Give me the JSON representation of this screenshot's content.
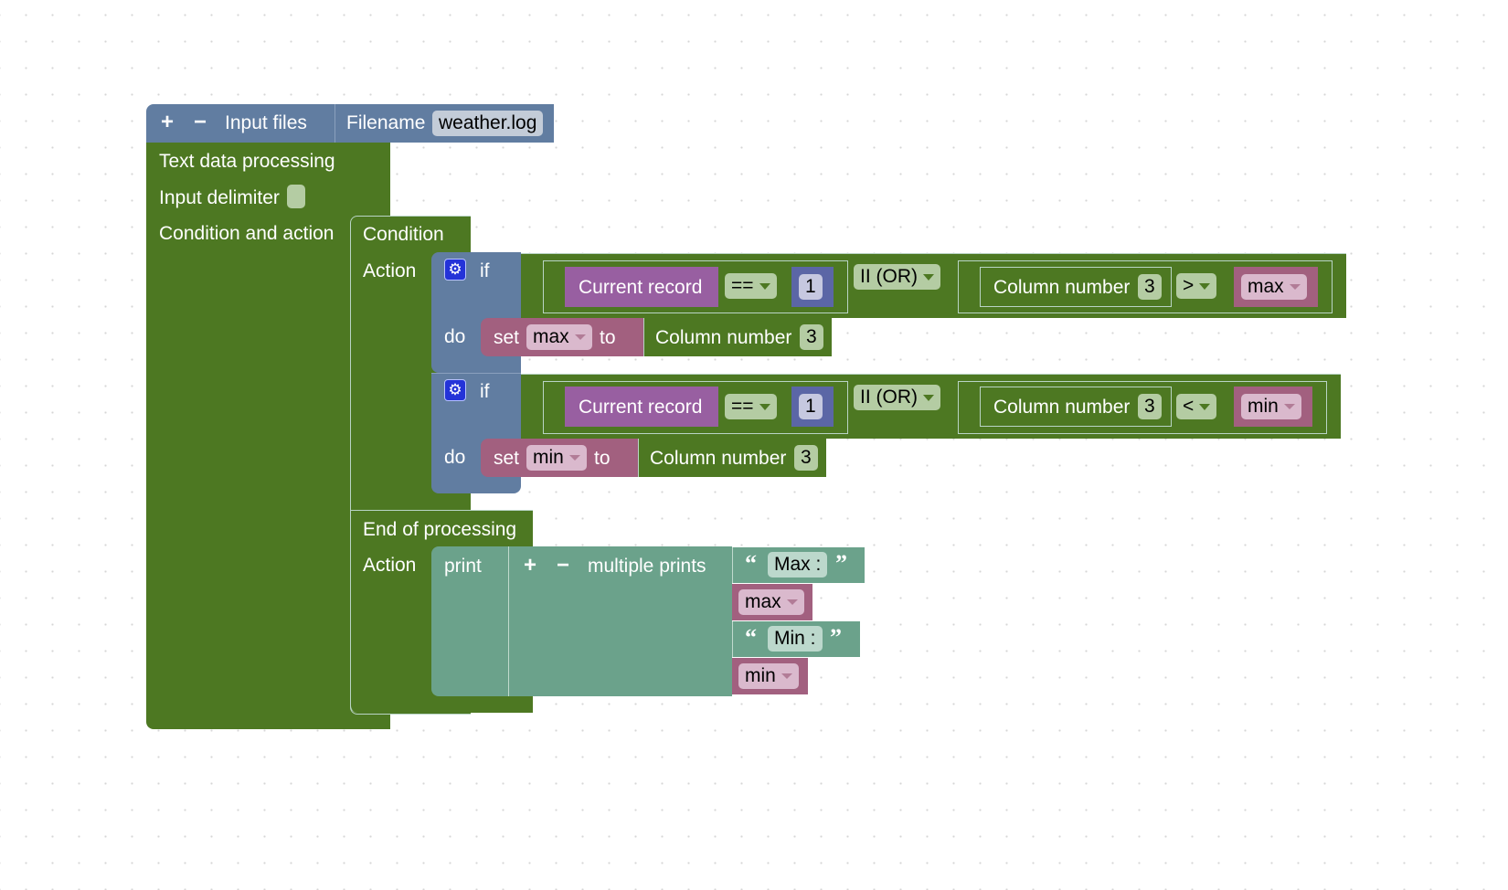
{
  "input_files_block": {
    "add_label": "+",
    "remove_label": "−",
    "title": "Input files",
    "filename_label": "Filename",
    "filename_value": "weather.log"
  },
  "text_processing_block": {
    "title": "Text data processing",
    "delimiter_label": "Input delimiter",
    "delimiter_value": "",
    "condition_action_label": "Condition and action"
  },
  "condition_block": {
    "condition_label": "Condition",
    "action_label": "Action"
  },
  "if_blocks": [
    {
      "if_label": "if",
      "do_label": "do",
      "left": {
        "field": "Current record",
        "operator": "==",
        "value": "1"
      },
      "logic": "II (OR)",
      "right": {
        "field": "Column number",
        "column": "3",
        "operator": ">",
        "variable": "max"
      },
      "set": {
        "set_label": "set",
        "variable": "max",
        "to_label": "to",
        "value_label": "Column number",
        "value_column": "3"
      }
    },
    {
      "if_label": "if",
      "do_label": "do",
      "left": {
        "field": "Current record",
        "operator": "==",
        "value": "1"
      },
      "logic": "II (OR)",
      "right": {
        "field": "Column number",
        "column": "3",
        "operator": "<",
        "variable": "min"
      },
      "set": {
        "set_label": "set",
        "variable": "min",
        "to_label": "to",
        "value_label": "Column number",
        "value_column": "3"
      }
    }
  ],
  "end_block": {
    "title": "End of processing",
    "action_label": "Action",
    "print_label": "print",
    "add_label": "+",
    "remove_label": "−",
    "multi_label": "multiple prints",
    "items": [
      {
        "type": "text",
        "value": "Max :"
      },
      {
        "type": "variable",
        "value": "max"
      },
      {
        "type": "text",
        "value": "Min :"
      },
      {
        "type": "variable",
        "value": "min"
      }
    ],
    "open_quote": "“",
    "close_quote": "”"
  },
  "colors": {
    "green": "#4d7822",
    "blue": "#617da1",
    "purple": "#985fa1",
    "mauve": "#a2607f",
    "teal": "#6ba28b",
    "navy": "#5b66a6"
  }
}
